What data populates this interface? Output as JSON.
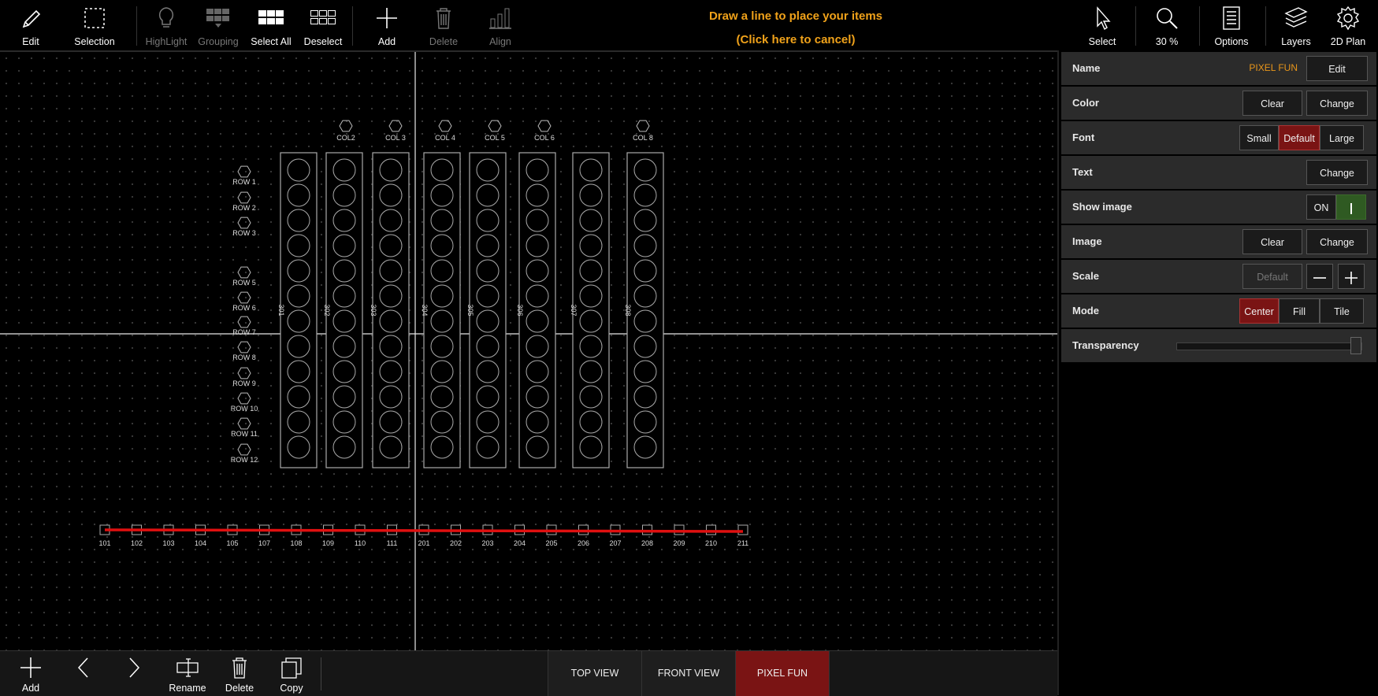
{
  "toolbar": {
    "edit": "Edit",
    "selection": "Selection",
    "highlight": "HighLight",
    "grouping": "Grouping",
    "select_all": "Select All",
    "deselect": "Deselect",
    "add": "Add",
    "delete": "Delete",
    "align": "Align",
    "message_line1": "Draw a line to place your items",
    "message_line2": "(Click here to cancel)",
    "select": "Select",
    "zoom": "30 %",
    "options": "Options",
    "layers": "Layers",
    "plan": "2D Plan"
  },
  "panel": {
    "name_label": "Name",
    "name_value": "PIXEL FUN",
    "name_edit": "Edit",
    "color_label": "Color",
    "color_clear": "Clear",
    "color_change": "Change",
    "font_label": "Font",
    "font_small": "Small",
    "font_default": "Default",
    "font_large": "Large",
    "text_label": "Text",
    "text_change": "Change",
    "show_image_label": "Show image",
    "show_image_state": "ON",
    "image_label": "Image",
    "image_clear": "Clear",
    "image_change": "Change",
    "scale_label": "Scale",
    "scale_default": "Default",
    "mode_label": "Mode",
    "mode_center": "Center",
    "mode_fill": "Fill",
    "mode_tile": "Tile",
    "transparency_label": "Transparency",
    "transparency_value": 1.0
  },
  "canvas": {
    "col_labels": [
      "COL2",
      "COL 3",
      "COL 4",
      "COL 5",
      "COL 6",
      "COL 8"
    ],
    "row_labels": [
      "ROW 1",
      "ROW 2",
      "ROW 3",
      "ROW 5",
      "ROW 6",
      "ROW 7",
      "ROW 8",
      "ROW 9",
      "ROW 10",
      "ROW 11",
      "ROW 12"
    ],
    "strip_labels": [
      "301",
      "302",
      "303",
      "304",
      "305",
      "306",
      "307",
      "308"
    ],
    "bottom_labels": [
      "101",
      "102",
      "103",
      "104",
      "105",
      "107",
      "108",
      "109",
      "110",
      "111",
      "201",
      "202",
      "203",
      "204",
      "205",
      "206",
      "207",
      "208",
      "209",
      "210",
      "211"
    ]
  },
  "bottombar": {
    "add": "Add",
    "rename": "Rename",
    "delete": "Delete",
    "copy": "Copy",
    "tabs": [
      "TOP VIEW",
      "FRONT VIEW",
      "PIXEL FUN"
    ],
    "active_tab": "PIXEL FUN"
  },
  "colors": {
    "accent_red": "#7a1414",
    "message_orange": "#f0a21a",
    "line_red": "#e01010",
    "on_green": "#2f5a22"
  }
}
